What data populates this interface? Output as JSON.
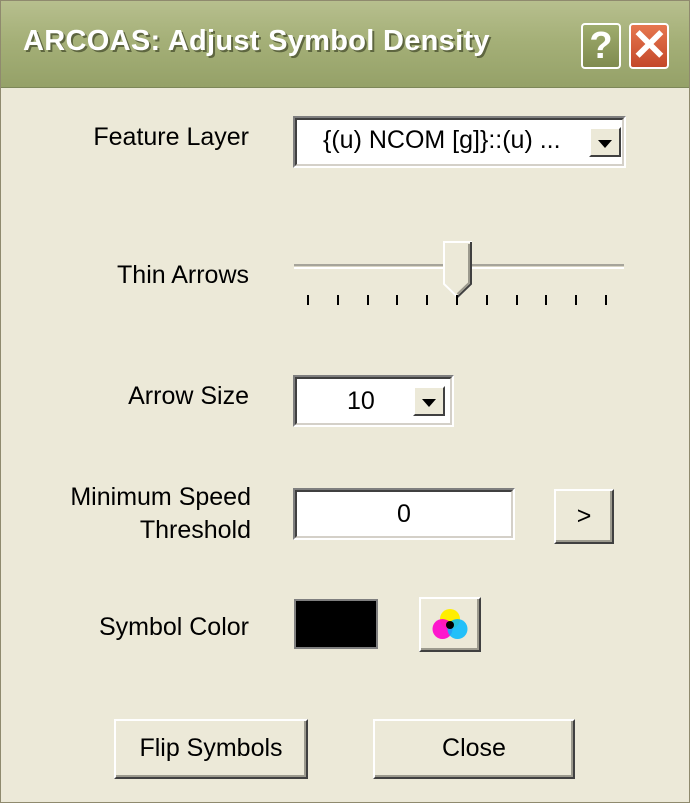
{
  "window": {
    "title": "ARCOAS:  Adjust Symbol Density",
    "help_glyph": "?",
    "close_glyph": "✕"
  },
  "feature_layer": {
    "label": "Feature Layer",
    "value": "{(u) NCOM [g]}::(u) ..."
  },
  "thin_arrows": {
    "label": "Thin Arrows",
    "tick_count": 11,
    "position_fraction": 0.5
  },
  "arrow_size": {
    "label": "Arrow Size",
    "value": "10"
  },
  "min_speed": {
    "label_line1": "Minimum Speed",
    "label_line2": "Threshold",
    "value": "0",
    "button_label": ">"
  },
  "symbol_color": {
    "label": "Symbol Color",
    "swatch_color": "#000000",
    "picker_icon": "color-wheel-icon"
  },
  "buttons": {
    "flip": "Flip Symbols",
    "close": "Close"
  },
  "colors": {
    "dialog_bg": "#ece9d8",
    "titlebar": "#a5b078",
    "close_button": "#d85a37"
  }
}
